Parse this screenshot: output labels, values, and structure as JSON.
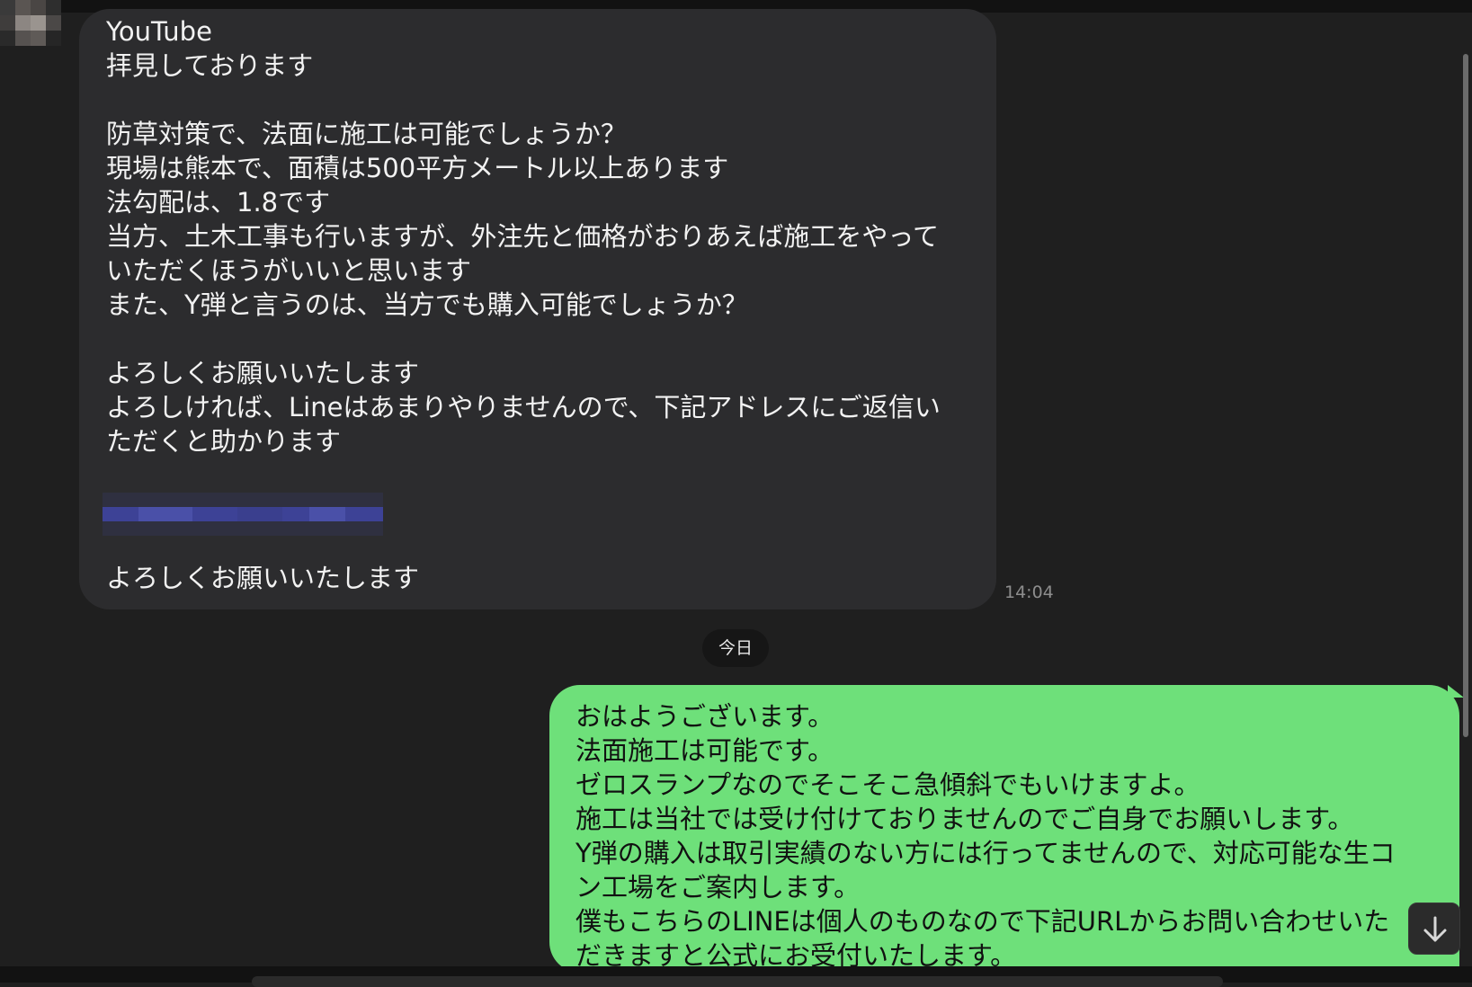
{
  "incoming_message": {
    "lines": [
      "YouTube",
      "拝見しております",
      "",
      "防草対策で、法面に施工は可能でしょうか？",
      "現場は熊本で、面積は500平方メートル以上あります",
      "法勾配は、1.8です",
      "当方、土木工事も行いますが、外注先と価格がおりあえば施工をやって",
      "いただくほうがいいと思います",
      "また、Y弾と言うのは、当方でも購入可能でしょうか？",
      "",
      "よろしくお願いいたします",
      "よろしければ、Lineはあまりやりませんので、下記アドレスにご返信い",
      "ただくと助かります",
      "",
      "",
      "",
      "よろしくお願いいたします"
    ],
    "time": "14:04"
  },
  "date_separator": "今日",
  "outgoing_message": {
    "lines": [
      "おはようございます。",
      "法面施工は可能です。",
      "ゼロスランプなのでそこそこ急傾斜でもいけますよ。",
      "施工は当社では受け付けておりませんのでご自身でお願いします。",
      "Y弾の購入は取引実績のない方には行ってませんので、対応可能な生コ",
      "ン工場をご案内します。",
      "僕もこちらのLINEは個人のものなので下記URLからお問い合わせいた",
      "だきますと公式にお受付いたします。"
    ]
  },
  "icons": {
    "scroll_down": "arrow-down-icon"
  },
  "colors": {
    "background": "#1f1f1f",
    "incoming_bubble": "#2c2c2e",
    "outgoing_bubble": "#6ee07a"
  }
}
